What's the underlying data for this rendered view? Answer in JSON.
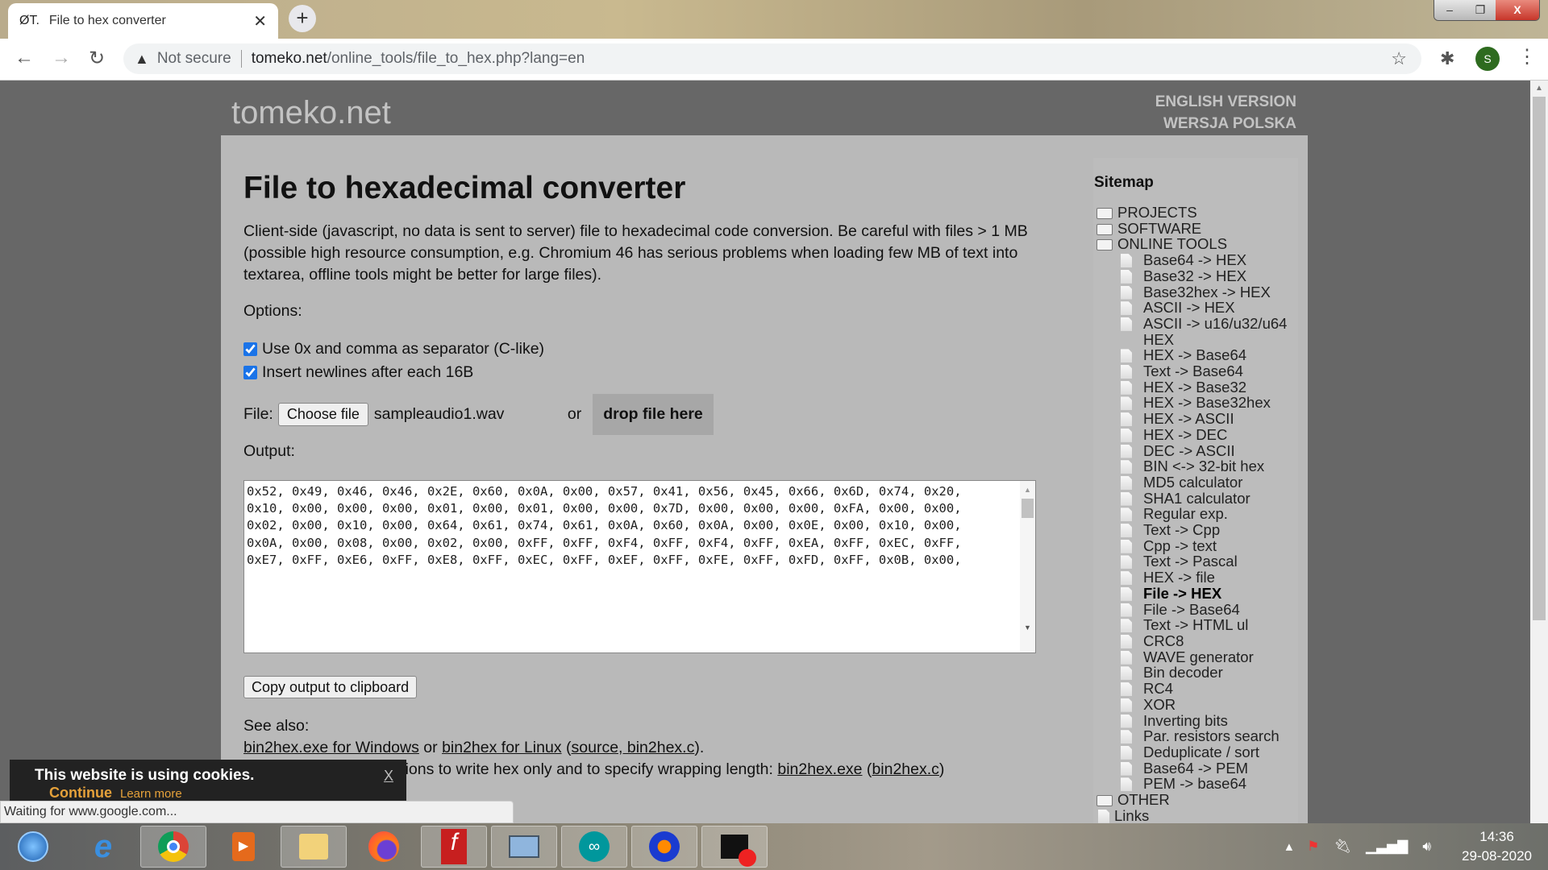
{
  "browser": {
    "tab_title": "File to hex converter",
    "tab_favicon": "ØT.",
    "security": "Not secure",
    "url_host": "tomeko.net",
    "url_path": "/online_tools/file_to_hex.php?lang=en",
    "profile_initial": "S"
  },
  "site": {
    "logo": "tomeko.net",
    "lang_en": "ENGLISH VERSION",
    "lang_pl": "WERSJA POLSKA"
  },
  "main": {
    "title": "File to hexadecimal converter",
    "description": "Client-side (javascript, no data is sent to server) file to hexadecimal code conversion. Be careful with files > 1 MB (possible high resource consumption, e.g. Chromium 46 has serious problems when loading few MB of text into textarea, offline tools might be better for large files).",
    "options_label": "Options:",
    "option1": {
      "label": "Use 0x and comma as separator (C-like)",
      "checked": true
    },
    "option2": {
      "label": "Insert newlines after each 16B",
      "checked": true
    },
    "file_label": "File:",
    "choose_file": "Choose file",
    "file_name": "sampleaudio1.wav",
    "or": "or",
    "drop_label": "drop file here",
    "output_label": "Output:",
    "output_value": "0x52, 0x49, 0x46, 0x46, 0x2E, 0x60, 0x0A, 0x00, 0x57, 0x41, 0x56, 0x45, 0x66, 0x6D, 0x74, 0x20,\n0x10, 0x00, 0x00, 0x00, 0x01, 0x00, 0x01, 0x00, 0x00, 0x7D, 0x00, 0x00, 0x00, 0xFA, 0x00, 0x00,\n0x02, 0x00, 0x10, 0x00, 0x64, 0x61, 0x74, 0x61, 0x0A, 0x60, 0x0A, 0x00, 0x0E, 0x00, 0x10, 0x00,\n0x0A, 0x00, 0x08, 0x00, 0x02, 0x00, 0xFF, 0xFF, 0xF4, 0xFF, 0xF4, 0xFF, 0xEA, 0xFF, 0xEC, 0xFF,\n0xE7, 0xFF, 0xE6, 0xFF, 0xE8, 0xFF, 0xEC, 0xFF, 0xEF, 0xFF, 0xFE, 0xFF, 0xFD, 0xFF, 0x0B, 0x00,",
    "copy_button": "Copy output to clipboard",
    "see_also": "See also:",
    "link_win": "bin2hex.exe for Windows",
    "or2": " or ",
    "link_linux": "bin2hex for Linux",
    "paren_open": " (",
    "link_source": "source, bin2hex.c",
    "paren_close": ").",
    "line2_text": "bin2hex with added options to write hex only and to specify wrapping length: ",
    "link_exe": "bin2hex.exe",
    "link_c": "bin2hex.c"
  },
  "sidebar": {
    "title": "Sitemap",
    "folders_top": [
      "PROJECTS",
      "SOFTWARE",
      "ONLINE TOOLS"
    ],
    "tools": [
      "Base64 -> HEX",
      "Base32 -> HEX",
      "Base32hex -> HEX",
      "ASCII -> HEX",
      "ASCII -> u16/u32/u64 HEX",
      "HEX -> Base64",
      "Text -> Base64",
      "HEX -> Base32",
      "HEX -> Base32hex",
      "HEX -> ASCII",
      "HEX -> DEC",
      "DEC -> ASCII",
      "BIN <-> 32-bit hex",
      "MD5 calculator",
      "SHA1 calculator",
      "Regular exp.",
      "Text -> Cpp",
      "Cpp -> text",
      "Text -> Pascal",
      "HEX -> file",
      "File -> HEX",
      "File -> Base64",
      "Text -> HTML ul",
      "CRC8",
      "WAVE generator",
      "Bin decoder",
      "RC4",
      "XOR",
      "Inverting bits",
      "Par. resistors search",
      "Deduplicate / sort",
      "Base64 -> PEM",
      "PEM -> base64"
    ],
    "current": "File -> HEX",
    "other": "OTHER",
    "links": "Links"
  },
  "cookie": {
    "text": "This website is using cookies.",
    "continue": "Continue",
    "learn": "Learn more",
    "close": "X"
  },
  "status_text": "Waiting for www.google.com...",
  "taskbar": {
    "apps": [
      "start",
      "internet-explorer",
      "chrome",
      "media-player",
      "file-explorer",
      "firefox",
      "foxit-reader",
      "on-screen-keyboard",
      "arduino",
      "audacity",
      "screen-recorder"
    ],
    "time": "14:36",
    "date": "29-08-2020"
  }
}
